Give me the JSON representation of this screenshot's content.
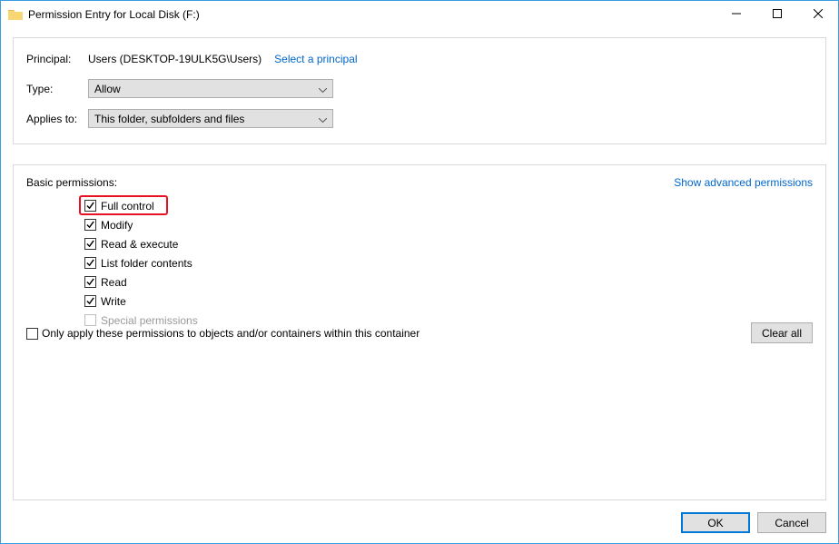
{
  "window": {
    "title": "Permission Entry for Local Disk (F:)"
  },
  "upper": {
    "principal_label": "Principal:",
    "principal_value": "Users (DESKTOP-19ULK5G\\Users)",
    "select_principal_link": "Select a principal",
    "type_label": "Type:",
    "type_value": "Allow",
    "applies_label": "Applies to:",
    "applies_value": "This folder, subfolders and files"
  },
  "lower": {
    "basic_permissions_label": "Basic permissions:",
    "show_advanced_link": "Show advanced permissions",
    "permissions": [
      {
        "label": "Full control",
        "checked": true,
        "disabled": false,
        "highlight": true
      },
      {
        "label": "Modify",
        "checked": true,
        "disabled": false,
        "highlight": false
      },
      {
        "label": "Read & execute",
        "checked": true,
        "disabled": false,
        "highlight": false
      },
      {
        "label": "List folder contents",
        "checked": true,
        "disabled": false,
        "highlight": false
      },
      {
        "label": "Read",
        "checked": true,
        "disabled": false,
        "highlight": false
      },
      {
        "label": "Write",
        "checked": true,
        "disabled": false,
        "highlight": false
      },
      {
        "label": "Special permissions",
        "checked": false,
        "disabled": true,
        "highlight": false
      }
    ],
    "only_apply_label": "Only apply these permissions to objects and/or containers within this container",
    "only_apply_checked": false,
    "clear_all_label": "Clear all"
  },
  "footer": {
    "ok_label": "OK",
    "cancel_label": "Cancel"
  }
}
